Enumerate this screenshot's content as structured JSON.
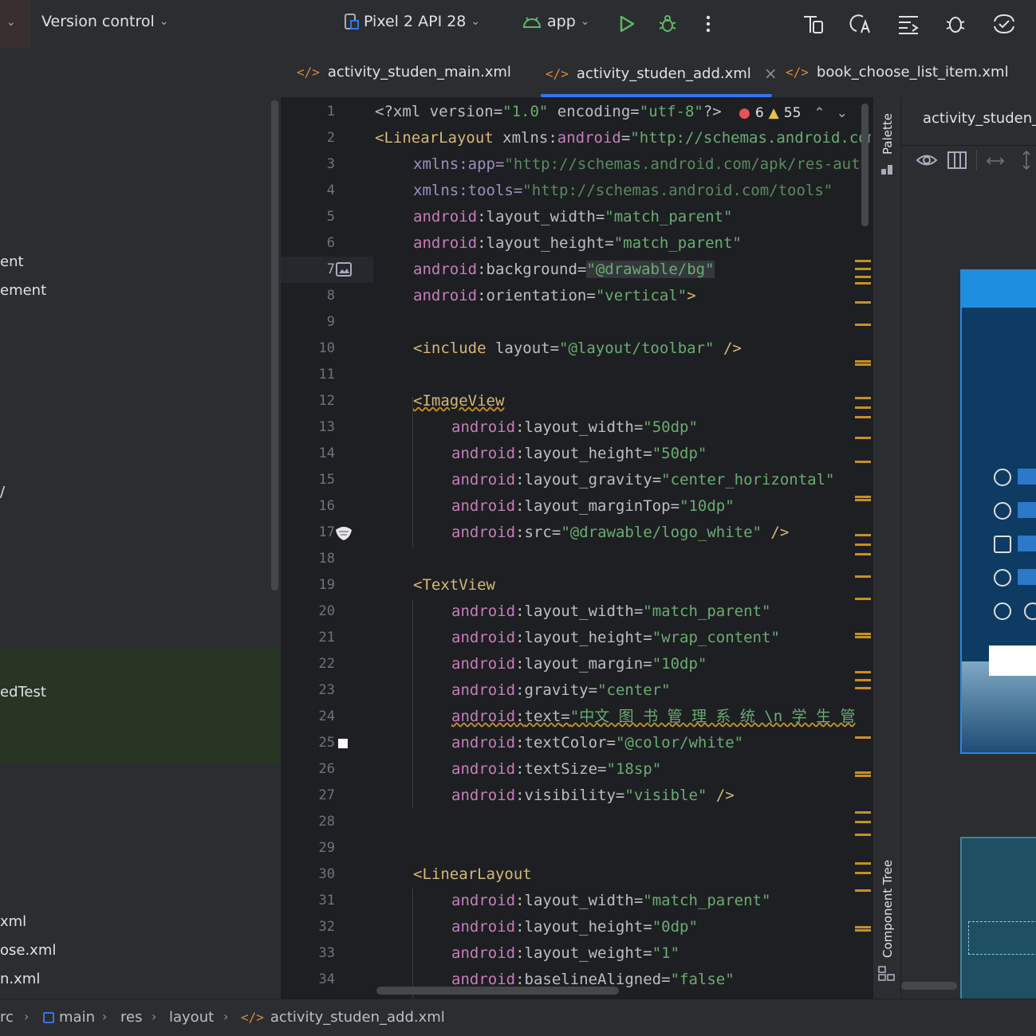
{
  "toolbar": {
    "vcs_label": "Version control",
    "device_label": "Pixel 2 API 28",
    "config_label": "app",
    "icons": [
      "run-icon",
      "debug-icon",
      "more-icon",
      "sync-gradle-icon",
      "translate-icon",
      "structure-icon",
      "debug-bridge-icon",
      "device-mirror-icon"
    ]
  },
  "project_tree": {
    "items": [
      {
        "label": "ent"
      },
      {
        "label": "ement"
      },
      {
        "label": "/"
      },
      {
        "label": "edTest"
      },
      {
        "label": "xml"
      },
      {
        "label": "ose.xml"
      },
      {
        "label": "n.xml"
      }
    ]
  },
  "tabs": [
    {
      "label": "activity_studen_main.xml"
    },
    {
      "label": "activity_studen_add.xml",
      "close": "×"
    },
    {
      "label": "book_choose_list_item.xml"
    }
  ],
  "inspections": {
    "errors": "6",
    "warnings": "55"
  },
  "code": {
    "line_numbers": [
      "1",
      "2",
      "3",
      "4",
      "5",
      "6",
      "7",
      "8",
      "9",
      "10",
      "11",
      "12",
      "13",
      "14",
      "15",
      "16",
      "17",
      "18",
      "19",
      "20",
      "21",
      "22",
      "23",
      "24",
      "25",
      "26",
      "27",
      "28",
      "29",
      "30",
      "31",
      "32",
      "33",
      "34"
    ],
    "l1a": "<?xml version=",
    "l1b": "\"1.0\"",
    "l1c": " encoding=",
    "l1d": "\"utf-8\"",
    "l1e": "?>",
    "l2a": "<LinearLayout",
    "l2b": " xmlns:",
    "l2c": "android",
    "l2d": "=",
    "l2e": "\"http://schemas.android.com/apk/res/android\"",
    "l3a": "xmlns:app=",
    "l3b": "\"http://schemas.android.com/apk/res-auto\"",
    "l4a": "xmlns:tools=",
    "l4b": "\"http://schemas.android.com/tools\"",
    "android": "android",
    "colon": ":",
    "eq": "=",
    "l5a": "layout_width",
    "l5b": "\"match_parent\"",
    "l6a": "layout_height",
    "l6b": "\"match_parent\"",
    "l7a": "background",
    "l7b": "\"@drawable/bg\"",
    "l8a": "orientation",
    "l8b": "\"vertical\"",
    "l8c": ">",
    "l10a": "<include",
    "l10b": " layout=",
    "l10c": "\"@layout/toolbar\"",
    "l10d": " />",
    "l12": "<ImageView",
    "l13a": "layout_width",
    "l13b": "\"50dp\"",
    "l14a": "layout_height",
    "l14b": "\"50dp\"",
    "l15a": "layout_gravity",
    "l15b": "\"center_horizontal\"",
    "l16a": "layout_marginTop",
    "l16b": "\"10dp\"",
    "l17a": "src",
    "l17b": "\"@drawable/logo_white\"",
    "l17c": " />",
    "l19": "<TextView",
    "l20a": "layout_width",
    "l20b": "\"match_parent\"",
    "l21a": "layout_height",
    "l21b": "\"wrap_content\"",
    "l22a": "layout_margin",
    "l22b": "\"10dp\"",
    "l23a": "gravity",
    "l23b": "\"center\"",
    "l24a": "text",
    "l24b": "\"中文 图 书 管 理 系 统 \\n 学 生 管",
    "l25a": "textColor",
    "l25b": "\"@color/white\"",
    "l26a": "textSize",
    "l26b": "\"18sp\"",
    "l27a": "visibility",
    "l27b": "\"visible\"",
    "l27c": " />",
    "l30": "<LinearLayout",
    "l31a": "layout_width",
    "l31b": "\"match_parent\"",
    "l32a": "layout_height",
    "l32b": "\"0dp\"",
    "l33a": "layout_weight",
    "l33b": "\"1\"",
    "l34a": "baselineAligned",
    "l34b": "\"false\""
  },
  "side_panel": {
    "palette": "Palette",
    "component_tree": "Component Tree",
    "design_title": "activity_studen_add.xml"
  },
  "breadcrumb": {
    "items": [
      "rc",
      "main",
      "res",
      "layout",
      "activity_studen_add.xml"
    ]
  },
  "colors": {
    "accent": "#3574f0",
    "xml_tag": "#d5b778",
    "attribute": "#c77dbb",
    "string": "#6aab73",
    "warning_mark": "#c69026"
  }
}
